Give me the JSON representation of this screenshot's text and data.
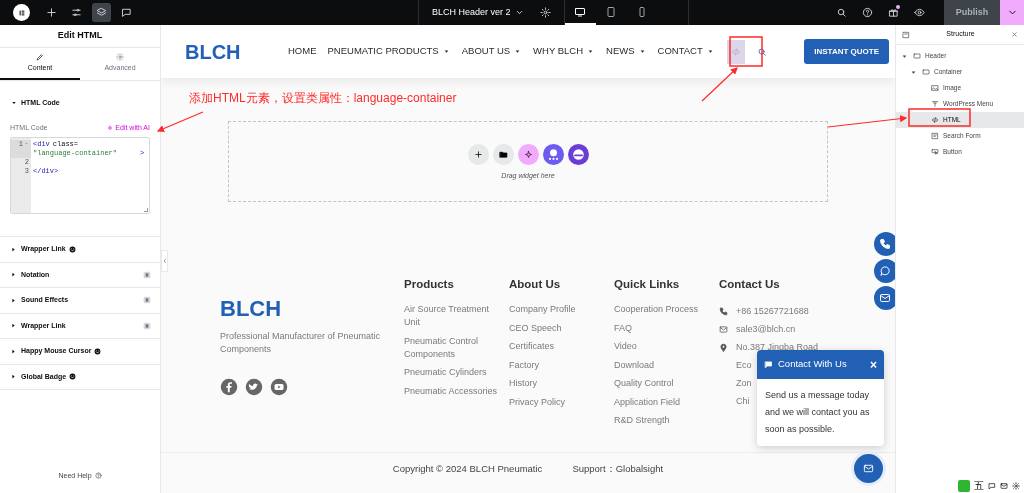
{
  "top_bar": {
    "document_title": "BLCH Header ver 2",
    "tools": [
      {
        "kind": "add",
        "selected": false
      },
      {
        "kind": "settings",
        "selected": false
      },
      {
        "kind": "structure",
        "selected": true
      },
      {
        "kind": "notes",
        "selected": false
      }
    ],
    "devices": [
      {
        "kind": "desktop",
        "selected": true
      },
      {
        "kind": "tablet",
        "selected": false
      },
      {
        "kind": "mobile",
        "selected": false
      }
    ],
    "publish": {
      "label": "Publish",
      "disabled": true
    }
  },
  "left_panel": {
    "title": "Edit HTML",
    "tabs": [
      {
        "label": "Content",
        "kind": "content",
        "selected": true
      },
      {
        "label": "Advanced",
        "kind": "advanced",
        "selected": false
      }
    ],
    "section": {
      "title": "HTML Code",
      "expanded": true
    },
    "field_label": "HTML Code",
    "ai_link": "Edit with AI",
    "code_lines": [
      {
        "number": "1",
        "tokens": [
          {
            "kind": "tag",
            "text": "<div"
          },
          {
            "kind": "attr",
            "text": "class="
          },
          {
            "kind": "string",
            "text": "\"language-container\""
          },
          {
            "kind": "tag",
            "text": ">"
          }
        ]
      },
      {
        "number": "2"
      },
      {
        "number": "3",
        "tokens": [
          {
            "kind": "tag",
            "text": "</div>"
          }
        ]
      }
    ],
    "sections": [
      {
        "title": "Wrapper Link",
        "kind": "happy",
        "expanded": false
      },
      {
        "title": "Notation",
        "kind": "pro",
        "expanded": false
      },
      {
        "title": "Sound Effects",
        "kind": "pro",
        "expanded": false
      },
      {
        "title": "Wrapper Link",
        "kind": "pro",
        "expanded": false
      },
      {
        "title": "Happy Mouse Cursor",
        "kind": "happy",
        "expanded": false
      },
      {
        "title": "Global Badge",
        "kind": "happy",
        "expanded": false
      }
    ],
    "help": "Need Help"
  },
  "canvas": {
    "header": {
      "logo": "BLCH",
      "nav": [
        {
          "label": "HOME",
          "dropdown": false
        },
        {
          "label": "PNEUMATIC PRODUCTS",
          "dropdown": true
        },
        {
          "label": "ABOUT US",
          "dropdown": true
        },
        {
          "label": "WHY BLCH",
          "dropdown": true
        },
        {
          "label": "NEWS",
          "dropdown": true
        },
        {
          "label": "CONTACT",
          "dropdown": true
        }
      ],
      "cta": "INSTANT QUOTE"
    },
    "annotation": "添加HTML元素，设置类属性：language-container",
    "drop_zone": {
      "hint": "Drag widget here"
    },
    "footer": {
      "logo": "BLCH",
      "tagline": "Professional Manufacturer of Pneumatic Components",
      "columns": [
        {
          "title": "Products",
          "items": [
            "Air Source Treatment Unit",
            "Pneumatic Control Components",
            "Pneumatic Cylinders",
            "Pneumatic Accessories"
          ]
        },
        {
          "title": "About Us",
          "items": [
            "Company Profile",
            "CEO Speech",
            "Certificates",
            "Factory",
            "History",
            "Privacy Policy"
          ]
        },
        {
          "title": "Quick Links",
          "items": [
            "Cooperation Process",
            "FAQ",
            "Video",
            "Download",
            "Quality Control",
            "Application Field",
            "R&D Strength"
          ]
        }
      ],
      "contact": {
        "title": "Contact Us",
        "items": [
          {
            "kind": "phone",
            "text": "+86 15267721688"
          },
          {
            "kind": "email",
            "text": "sale3@blch.cn"
          },
          {
            "kind": "location",
            "text": "No.387 Jingba Road"
          },
          {
            "kind": "continuation",
            "text": "Eco"
          },
          {
            "kind": "continuation",
            "text": "Zon"
          },
          {
            "kind": "continuation",
            "text": "Chi"
          }
        ]
      },
      "copyright": "Copyright © 2024 BLCH Pneumatic",
      "support": "Support：Globalsight"
    },
    "contact_popup": {
      "title": "Contact With Us",
      "close": "×",
      "message": "Send us a message today and we will contact you as soon as possible."
    }
  },
  "structure": {
    "title": "Structure",
    "tree": [
      {
        "label": "Header",
        "kind": "container",
        "expanded": true,
        "selected": false,
        "children": [
          {
            "label": "Container",
            "kind": "container",
            "expanded": true,
            "selected": false,
            "children": [
              {
                "label": "Image",
                "kind": "image",
                "selected": false
              },
              {
                "label": "WordPress Menu",
                "kind": "menu",
                "selected": false
              },
              {
                "label": "HTML",
                "kind": "html",
                "selected": true
              },
              {
                "label": "Search Form",
                "kind": "search-form",
                "selected": false
              },
              {
                "label": "Button",
                "kind": "button",
                "selected": false
              }
            ]
          }
        ]
      }
    ]
  },
  "ime_toolbar": {
    "label": "五"
  }
}
